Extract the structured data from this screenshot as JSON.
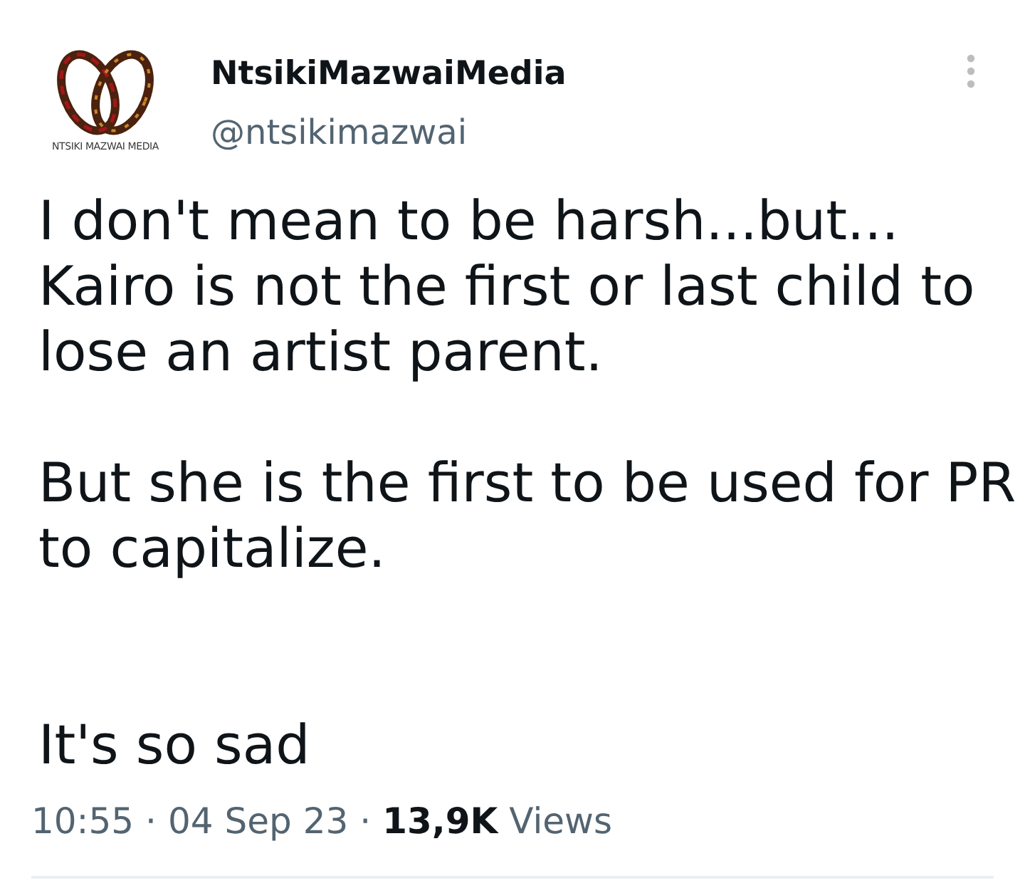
{
  "author": {
    "logo_text": "NTSIKI MAZWAI MEDIA",
    "name": "NtsikiMazwaiMedia",
    "handle": "@ntsikimazwai"
  },
  "tweet": {
    "text": "I don't mean to be harsh...but...\nKairo is not the first or last child to\nlose an artist parent.\n\nBut she is the first to be used for PR\nto capitalize.\n\n\nIt's so sad"
  },
  "meta": [
    {
      "kind": "time",
      "text": "10:55"
    },
    {
      "kind": "dot",
      "text": "·"
    },
    {
      "kind": "date",
      "text": "04 Sep 23"
    },
    {
      "kind": "dot",
      "text": "·"
    },
    {
      "kind": "count",
      "text": "13,9K"
    },
    {
      "kind": "label",
      "text": "Views"
    }
  ]
}
